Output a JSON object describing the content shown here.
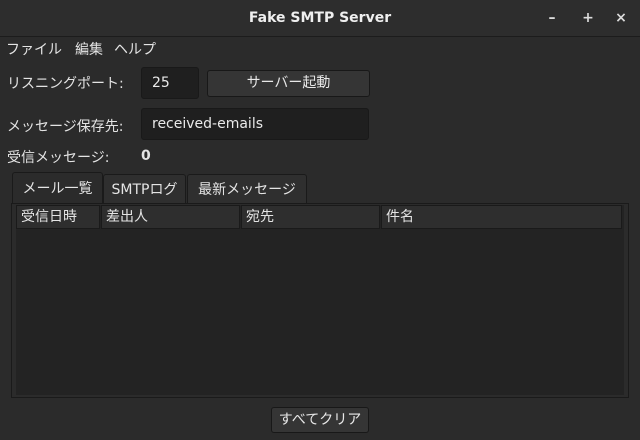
{
  "window": {
    "title": "Fake SMTP Server",
    "minimize_glyph": "–",
    "maximize_glyph": "+",
    "close_glyph": "×"
  },
  "menu": {
    "items": [
      {
        "label": "ファイル"
      },
      {
        "label": "編集"
      },
      {
        "label": "ヘルプ"
      }
    ]
  },
  "form": {
    "port_label": "リスニングポート:",
    "port_value": "25",
    "start_button": "サーバー起動",
    "dir_label": "メッセージ保存先:",
    "dir_value": "received-emails",
    "received_label": "受信メッセージ:",
    "received_count": "0"
  },
  "tabs": [
    {
      "label": "メール一覧",
      "active": true
    },
    {
      "label": "SMTPログ",
      "active": false
    },
    {
      "label": "最新メッセージ",
      "active": false
    }
  ],
  "table": {
    "columns": [
      "受信日時",
      "差出人",
      "宛先",
      "件名"
    ],
    "rows": []
  },
  "footer": {
    "clear_button": "すべてクリア"
  }
}
